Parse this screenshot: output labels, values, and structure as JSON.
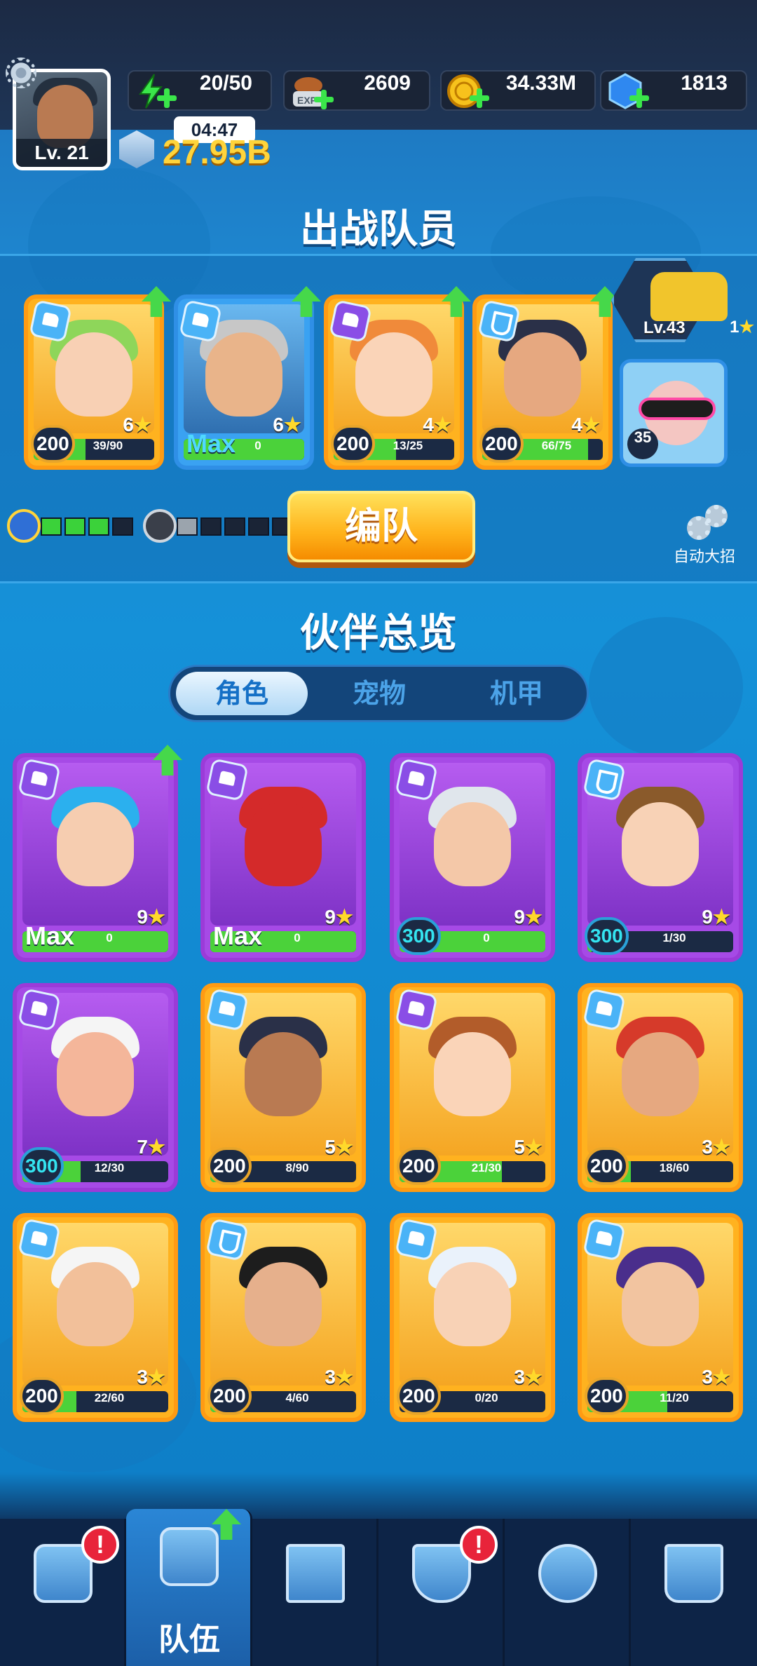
{
  "player": {
    "level": "Lv. 21",
    "power": "27.95B",
    "stamina_timer": "04:47"
  },
  "resources": [
    {
      "icon": "lightning-icon",
      "value": "20/50"
    },
    {
      "icon": "exp-bag-icon",
      "value": "2609"
    },
    {
      "icon": "gold-coin-icon",
      "value": "34.33M"
    },
    {
      "icon": "blue-gem-icon",
      "value": "1813"
    }
  ],
  "team": {
    "title": "出战队员",
    "members": [
      {
        "level": "200",
        "stars": "6",
        "fragments": "39/90",
        "progress": 0.43
      },
      {
        "level": "Max",
        "stars": "6",
        "fragments": "0",
        "progress": 1.0
      },
      {
        "level": "200",
        "stars": "4",
        "fragments": "13/25",
        "progress": 0.52
      },
      {
        "level": "200",
        "stars": "4",
        "fragments": "66/75",
        "progress": 0.88
      }
    ],
    "mech": {
      "level": "Lv.43",
      "stars": "1"
    },
    "pet": {
      "level": "35"
    },
    "form_button": "编队",
    "auto_ult_label": "自动大招",
    "progress_a": 3,
    "progress_b": 1
  },
  "overview": {
    "title": "伙伴总览",
    "tabs": [
      "角色",
      "宠物",
      "机甲"
    ],
    "cards": [
      {
        "level": "Max",
        "stars": "9",
        "fragments": "0",
        "progress": 1.0
      },
      {
        "level": "Max",
        "stars": "9",
        "fragments": "0",
        "progress": 1.0
      },
      {
        "level": "300",
        "stars": "9",
        "fragments": "0",
        "progress": 1.0
      },
      {
        "level": "300",
        "stars": "9",
        "fragments": "1/30",
        "progress": 0.03
      },
      {
        "level": "300",
        "stars": "7",
        "fragments": "12/30",
        "progress": 0.4
      },
      {
        "level": "200",
        "stars": "5",
        "fragments": "8/90",
        "progress": 0.09
      },
      {
        "level": "200",
        "stars": "5",
        "fragments": "21/30",
        "progress": 0.7
      },
      {
        "level": "200",
        "stars": "3",
        "fragments": "18/60",
        "progress": 0.3
      },
      {
        "level": "200",
        "stars": "3",
        "fragments": "22/60",
        "progress": 0.37
      },
      {
        "level": "200",
        "stars": "3",
        "fragments": "4/60",
        "progress": 0.07
      },
      {
        "level": "200",
        "stars": "3",
        "fragments": "0/20",
        "progress": 0.0
      },
      {
        "level": "200",
        "stars": "3",
        "fragments": "11/20",
        "progress": 0.55
      }
    ]
  },
  "bottom_nav": {
    "items": [
      {
        "icon": "tv-shop-icon",
        "label": ""
      },
      {
        "icon": "team-hourglass-icon",
        "label": "队伍"
      },
      {
        "icon": "map-icon",
        "label": ""
      },
      {
        "icon": "shield-helmet-icon",
        "label": ""
      },
      {
        "icon": "target-icon",
        "label": ""
      },
      {
        "icon": "guild-banner-icon",
        "label": ""
      }
    ],
    "alert": "!"
  }
}
